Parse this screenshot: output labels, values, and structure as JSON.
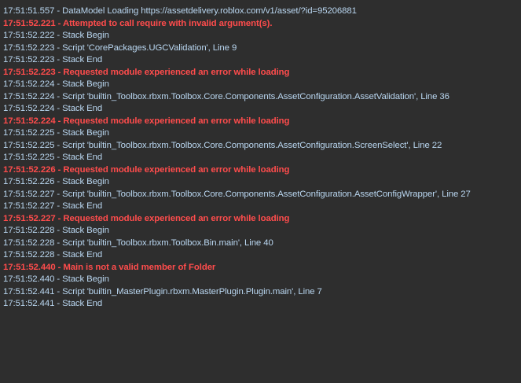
{
  "output": {
    "lines": [
      {
        "text": "17:51:51.557 - DataModel Loading https://assetdelivery.roblox.com/v1/asset/?id=95206881",
        "level": "info"
      },
      {
        "text": "17:51:52.221 - Attempted to call require with invalid argument(s).",
        "level": "error"
      },
      {
        "text": "17:51:52.222 - Stack Begin",
        "level": "info"
      },
      {
        "text": "17:51:52.223 - Script 'CorePackages.UGCValidation', Line 9",
        "level": "info"
      },
      {
        "text": "17:51:52.223 - Stack End",
        "level": "info"
      },
      {
        "text": "17:51:52.223 - Requested module experienced an error while loading",
        "level": "error"
      },
      {
        "text": "17:51:52.224 - Stack Begin",
        "level": "info"
      },
      {
        "text": "17:51:52.224 - Script 'builtin_Toolbox.rbxm.Toolbox.Core.Components.AssetConfiguration.AssetValidation', Line 36",
        "level": "info"
      },
      {
        "text": "17:51:52.224 - Stack End",
        "level": "info"
      },
      {
        "text": "17:51:52.224 - Requested module experienced an error while loading",
        "level": "error"
      },
      {
        "text": "17:51:52.225 - Stack Begin",
        "level": "info"
      },
      {
        "text": "17:51:52.225 - Script 'builtin_Toolbox.rbxm.Toolbox.Core.Components.AssetConfiguration.ScreenSelect', Line 22",
        "level": "info"
      },
      {
        "text": "17:51:52.225 - Stack End",
        "level": "info"
      },
      {
        "text": "17:51:52.226 - Requested module experienced an error while loading",
        "level": "error"
      },
      {
        "text": "17:51:52.226 - Stack Begin",
        "level": "info"
      },
      {
        "text": "17:51:52.227 - Script 'builtin_Toolbox.rbxm.Toolbox.Core.Components.AssetConfiguration.AssetConfigWrapper', Line 27",
        "level": "info"
      },
      {
        "text": "17:51:52.227 - Stack End",
        "level": "info"
      },
      {
        "text": "17:51:52.227 - Requested module experienced an error while loading",
        "level": "error"
      },
      {
        "text": "17:51:52.228 - Stack Begin",
        "level": "info"
      },
      {
        "text": "17:51:52.228 - Script 'builtin_Toolbox.rbxm.Toolbox.Bin.main', Line 40",
        "level": "info"
      },
      {
        "text": "17:51:52.228 - Stack End",
        "level": "info"
      },
      {
        "text": "17:51:52.440 - Main is not a valid member of Folder",
        "level": "error"
      },
      {
        "text": "17:51:52.440 - Stack Begin",
        "level": "info"
      },
      {
        "text": "17:51:52.441 - Script 'builtin_MasterPlugin.rbxm.MasterPlugin.Plugin.main', Line 7",
        "level": "info"
      },
      {
        "text": "17:51:52.441 - Stack End",
        "level": "info"
      }
    ]
  },
  "colors": {
    "background": "#2e2e2e",
    "info_text": "#b9d6f0",
    "error_text": "#ff4c4c"
  }
}
